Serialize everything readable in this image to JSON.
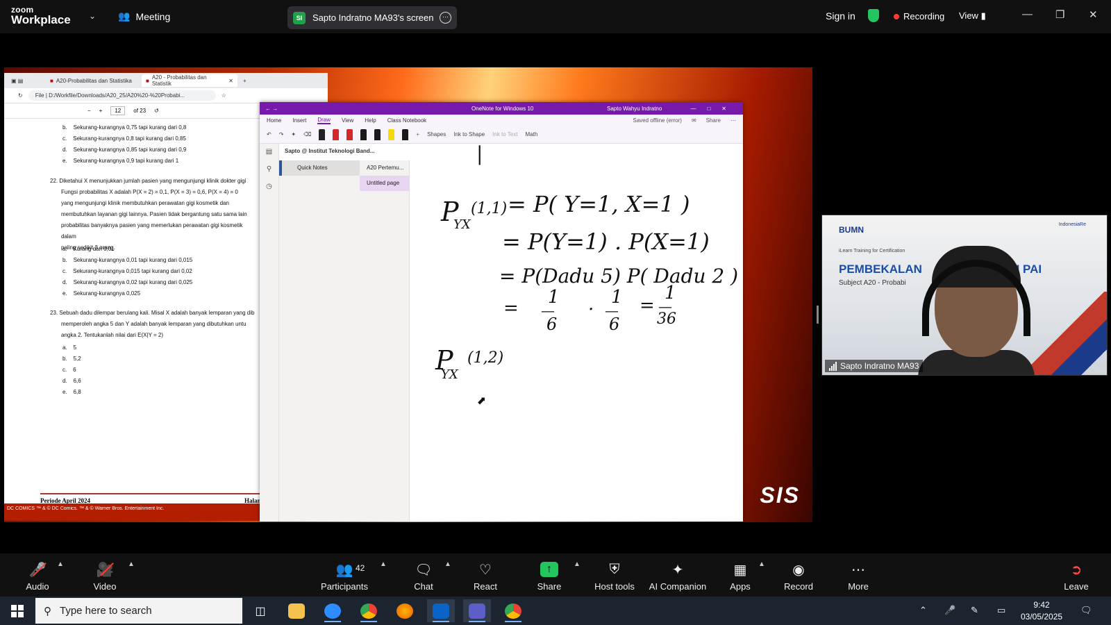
{
  "zoom": {
    "brand_line1": "zoom",
    "brand_line2": "Workplace",
    "meeting_label": "Meeting",
    "screen_share_avatar": "SI",
    "screen_share_label": "Sapto Indratno MA93's screen",
    "sign_in": "Sign in",
    "recording_label": "Recording",
    "view_label": "View",
    "toolbar": [
      {
        "key": "audio",
        "label": "Audio"
      },
      {
        "key": "video",
        "label": "Video"
      },
      {
        "key": "participants",
        "label": "Participants",
        "count": "42"
      },
      {
        "key": "chat",
        "label": "Chat"
      },
      {
        "key": "react",
        "label": "React"
      },
      {
        "key": "share",
        "label": "Share"
      },
      {
        "key": "host_tools",
        "label": "Host tools"
      },
      {
        "key": "ai_companion",
        "label": "AI Companion"
      },
      {
        "key": "apps",
        "label": "Apps"
      },
      {
        "key": "record",
        "label": "Record"
      },
      {
        "key": "more",
        "label": "More"
      },
      {
        "key": "leave",
        "label": "Leave"
      }
    ],
    "accent_green": "#22c55e",
    "recording_color": "#ff3b30"
  },
  "shared_screen": {
    "background_logo": "SIS",
    "pdf_browser": {
      "tabs": [
        "A20-Probabilitas dan Statistika",
        "A20 - Probabilitas dan Statistik"
      ],
      "address_prefix": "File",
      "address": "D:/Workfile/Downloads/A20_25/A20%20-%20Probabi...",
      "page_current": "12",
      "page_total": "of 23",
      "options_top": [
        {
          "letter": "b.",
          "text": "Sekurang-kurangnya 0,75 tapi kurang dari 0,8"
        },
        {
          "letter": "c.",
          "text": "Sekurang-kurangnya 0,8 tapi kurang dari 0,85"
        },
        {
          "letter": "d.",
          "text": "Sekurang-kurangnya 0,85 tapi kurang dari 0,9"
        },
        {
          "letter": "e.",
          "text": "Sekurang-kurangnya 0,9 tapi kurang dari 1"
        }
      ],
      "q22_lines": [
        "22. Diketahui X menunjukkan jumlah pasien yang mengunjungi klinik dokter gigi",
        "Fungsi probabilitas X adalah P(X = 2) = 0,1, P(X = 3) = 0,6, P(X = 4) = 0",
        "yang mengunjungi klinik membutuhkan perawatan gigi kosmetik dan",
        "membutuhkan layanan gigi lainnya. Pasien tidak bergantung satu sama lain",
        "probabilitas banyaknya pasien yang memerlukan perawatan gigi kosmetik dalam",
        "paling sedikit 3 orang."
      ],
      "q22_options": [
        {
          "letter": "a.",
          "text": "Kurang dari 0,01"
        },
        {
          "letter": "b.",
          "text": "Sekurang-kurangnya 0,01 tapi kurang dari 0,015"
        },
        {
          "letter": "c.",
          "text": "Sekurang-kurangnya 0,015 tapi kurang dari 0,02"
        },
        {
          "letter": "d.",
          "text": "Sekurang-kurangnya 0,02 tapi kurang dari 0,025"
        },
        {
          "letter": "e.",
          "text": "Sekurang-kurangnya 0,025"
        }
      ],
      "q23_lines": [
        "23. Sebuah dadu dilempar berulang kali. Misal X adalah banyak lemparan yang dib",
        "memperoleh angka 5 dan Y adalah banyak lemparan yang dibutuhkan untu",
        "angka 2. Tentukanlah nilai dari E(X|Y = 2)"
      ],
      "q23_options": [
        {
          "letter": "a.",
          "text": "5"
        },
        {
          "letter": "b.",
          "text": "5,2"
        },
        {
          "letter": "c.",
          "text": "6"
        },
        {
          "letter": "d.",
          "text": "6,6"
        },
        {
          "letter": "e.",
          "text": "6,8"
        }
      ],
      "footer_left": "Periode April 2024",
      "footer_right": "Halam",
      "bottom_banner": "DC COMICS  ™ & © DC Comics. ™ & © Warner Bros. Entertainment Inc."
    },
    "onenote": {
      "title": "OneNote for Windows 10",
      "user": "Sapto Wahyu Indratno",
      "menu": [
        "Home",
        "Insert",
        "Draw",
        "View",
        "Help",
        "Class Notebook"
      ],
      "active_menu": "Draw",
      "status": "Saved offline (error)",
      "share_label": "Share",
      "ribbon_items": [
        "Shapes",
        "Ink to Shape",
        "Ink to Text",
        "Math"
      ],
      "pen_colors": [
        "#222222",
        "#d62828",
        "#d62828",
        "#1a1a1a",
        "#1a1a1a",
        "#f5d90a",
        "#1a1a1a"
      ],
      "notebook": "Sapto @ Institut Teknologi Band...",
      "section": "Quick Notes",
      "pages": [
        "A20 Pertemu...",
        "Untitled page"
      ],
      "active_page": "Untitled page",
      "ink": {
        "line1_lhs": "P",
        "line1_sub": "YX",
        "line1_arg": "(1,1)",
        "line1_rhs": "= P( Y=1, X=1 )",
        "line2": "= P(Y=1) . P(X=1)",
        "line3": "= P(Dadu 5) P( Dadu 2 )",
        "frac_num": "1",
        "frac1_den": "6",
        "frac2_den": "6",
        "frac3_num": "1",
        "frac3_den": "36",
        "line5_lhs": "P",
        "line5_sub": "YX",
        "line5_arg": "(1,2)"
      }
    }
  },
  "speaker_video": {
    "org_left": "BUMN",
    "org_right": "IndonesiaRe",
    "subtitle": "iLearn Training for Certification",
    "title": "PEMBEKALAN",
    "title_tail": "ASI PAI",
    "subject": "Subject A20 - Probabi",
    "name": "Sapto Indratno MA93"
  },
  "taskbar": {
    "search_placeholder": "Type here to search",
    "time": "9:42",
    "date": "03/05/2025"
  }
}
